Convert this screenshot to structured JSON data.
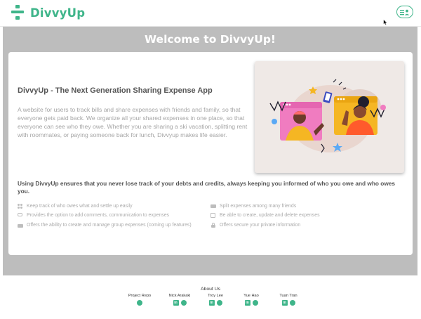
{
  "header": {
    "brand": "DivvyUp",
    "menu_icon": "user-menu-icon"
  },
  "hero": {
    "welcome": "Welcome to DivvyUp!",
    "app_title": "DivvyUp - The Next Generation Sharing Expense App",
    "description": "A website for users to track bills and share expenses with friends and family, so that everyone gets paid back. We organize all your shared expenses in one place, so that everyone can see who they owe. Whether you are sharing a ski vacation, splitting rent with roommates, or paying someone back for lunch, Divvyup makes life easier.",
    "tagline": "Using DivvyUp ensures that you never lose track of your debts and credits, always keeping you informed of who you owe and who owes you."
  },
  "features": [
    {
      "label": "Keep track of who owes what and settle up easily",
      "icon": "users-icon"
    },
    {
      "label": "Provides the option to add comments, communication to expenses",
      "icon": "comments-icon"
    },
    {
      "label": "Offers the ability to create and manage group expenses (coming up features)",
      "icon": "group-icon"
    },
    {
      "label": "Split expenses among many friends",
      "icon": "money-icon"
    },
    {
      "label": "Be able to create, update and delete expenses",
      "icon": "edit-icon"
    },
    {
      "label": "Offers secure your private information",
      "icon": "lock-icon"
    }
  ],
  "footer": {
    "about": "About Us",
    "members": [
      {
        "name": "Project Repo",
        "icons": [
          "github-icon"
        ]
      },
      {
        "name": "Nick Arakaki",
        "icons": [
          "linkedin-icon",
          "github-icon"
        ]
      },
      {
        "name": "Troy Lee",
        "icons": [
          "linkedin-icon",
          "github-icon"
        ]
      },
      {
        "name": "Yue Hao",
        "icons": [
          "linkedin-icon",
          "github-icon"
        ]
      },
      {
        "name": "Tuan Tran",
        "icons": [
          "linkedin-icon",
          "github-icon"
        ]
      }
    ]
  },
  "colors": {
    "brand": "#3fb58a",
    "hero_bg": "#bdbdbd",
    "card_bg": "#ffffff"
  }
}
